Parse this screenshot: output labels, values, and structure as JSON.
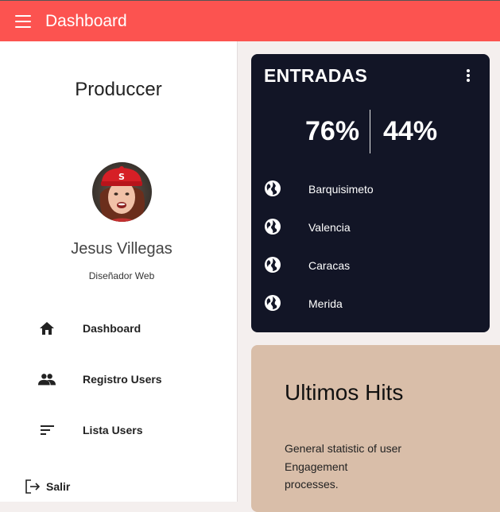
{
  "topbar": {
    "title": "Dashboard",
    "color": "#fc5350"
  },
  "sidebar": {
    "brand": "Produccer",
    "user": {
      "name": "Jesus Villegas",
      "role": "Diseñador Web"
    },
    "nav": [
      {
        "label": "Dashboard",
        "icon": "home-icon"
      },
      {
        "label": "Registro Users",
        "icon": "people-icon"
      },
      {
        "label": "Lista Users",
        "icon": "sort-list-icon"
      }
    ],
    "logout": {
      "label": "Salir",
      "icon": "logout-icon"
    }
  },
  "entradas_card": {
    "title": "ENTRADAS",
    "stats": [
      "76%",
      "44%"
    ],
    "cities": [
      "Barquisimeto",
      "Valencia",
      "Caracas",
      "Merida"
    ],
    "city_icon": "globe-icon",
    "background": "#121526"
  },
  "hits_card": {
    "title": "Ultimos Hits",
    "description": "General statistic of user Engagement processes.",
    "background": "#d9bea9"
  }
}
